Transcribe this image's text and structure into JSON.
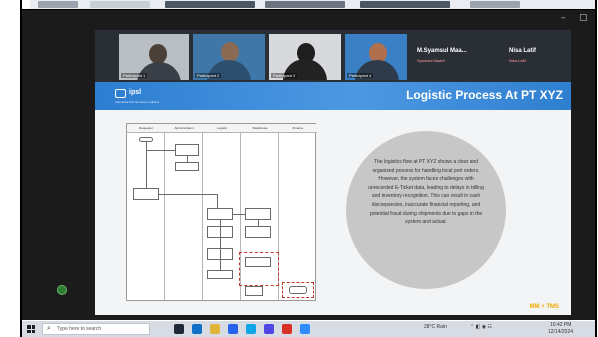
{
  "slide": {
    "title": "Logistic Process At PT XYZ",
    "logo_text": "ipsl",
    "logo_subtext": "Indonesia Port Services Logistics",
    "footer_tag": "MM + TMS",
    "description": "The logistics flow at PT XYZ shows a clear and organized process for handling local port orders. However, the system faces challenges with unrecorded E-Ticket data, leading to delays in billing and inventory recognition. This can result in cash discrepancies, inaccurate financial reporting, and potential fraud during shipments due to gaps in the system and actual."
  },
  "participants": [
    {
      "name": "Participant 1"
    },
    {
      "name": "Participant 2"
    },
    {
      "name": "Participant 3"
    },
    {
      "name": "Participant 4"
    }
  ],
  "name_tiles": [
    {
      "name": "M.Syamsul Maa...",
      "sub": "Syamsul Maarif"
    },
    {
      "name": "Nisa Latif",
      "sub": "Nisa Latif"
    }
  ],
  "flowchart": {
    "lanes": [
      "Requester",
      "Administration",
      "Logistic",
      "Warehouse",
      "Finance"
    ]
  },
  "window_controls": {
    "minimize": "–",
    "restore": "▢"
  },
  "taskbar": {
    "search_placeholder": "Type here to search",
    "weather": "28°C Rain",
    "time": "10:42 PM",
    "date": "12/14/2024"
  },
  "colors": {
    "title_bar": "#3a8ad8",
    "circle": "#c7c7c7",
    "footer_tag": "#f2a900",
    "highlight_dash": "#c0392b"
  }
}
